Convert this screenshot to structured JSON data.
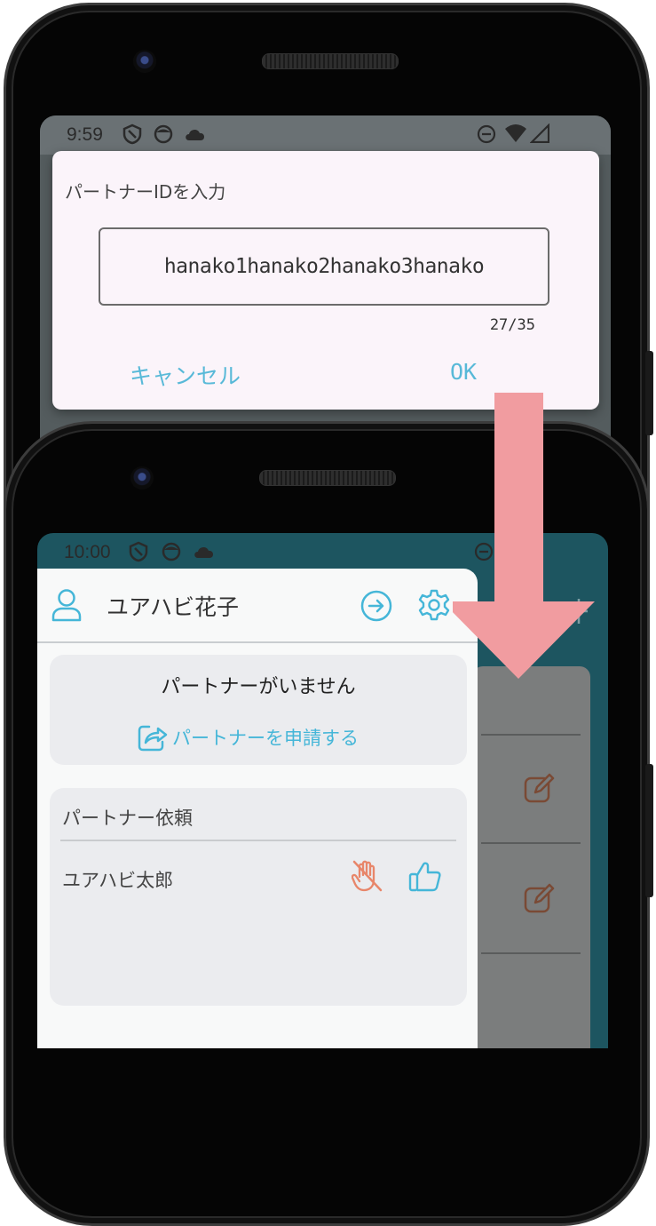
{
  "top_screen": {
    "status_time": "9:59",
    "dialog": {
      "title": "パートナーIDを入力",
      "input_value": "hanako1hanako2hanako3hanako",
      "counter": "27/35",
      "cancel_label": "キャンセル",
      "ok_label": "OK"
    }
  },
  "bottom_screen": {
    "status_time": "10:00",
    "user_name": "ユアハビ花子",
    "partner_card": {
      "status_text": "パートナーがいません",
      "apply_link": "パートナーを申請する"
    },
    "requests_card": {
      "title": "パートナー依頼",
      "requester_name": "ユアハビ太郎"
    }
  },
  "colors": {
    "accent": "#45b6d8",
    "reject": "#e8866a",
    "arrow": "#f19ca0",
    "statusbar": "#1d5560"
  },
  "icons": [
    "user-icon",
    "logout-icon",
    "settings-icon",
    "share-icon",
    "reject-hand-icon",
    "thumbs-up-icon",
    "edit-icon",
    "plus-icon"
  ]
}
